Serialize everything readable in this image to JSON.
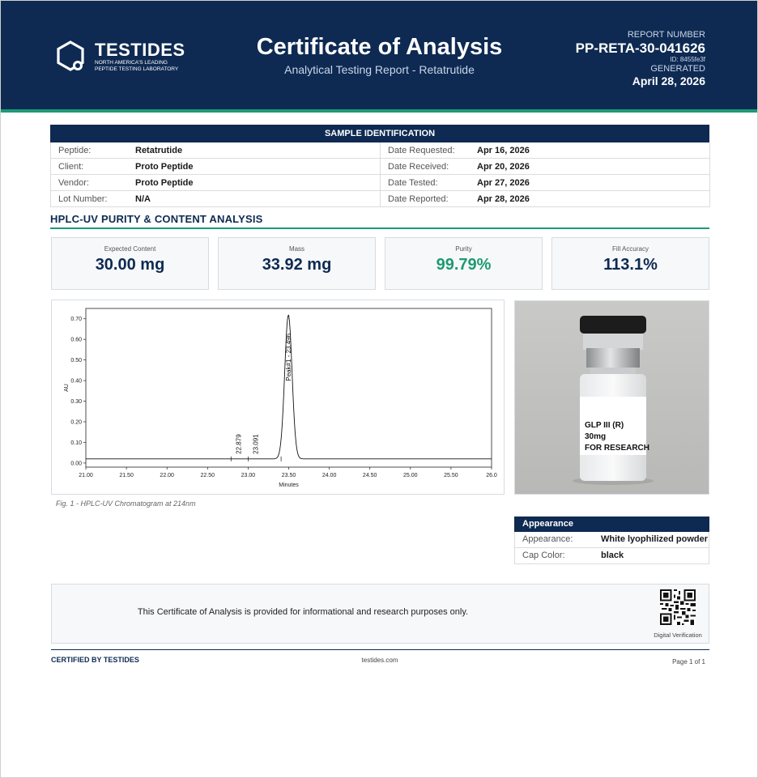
{
  "header": {
    "brand": "TESTIDES",
    "tagline_line1": "NORTH AMERICA'S LEADING",
    "tagline_line2": "PEPTIDE TESTING LABORATORY",
    "title": "Certificate of Analysis",
    "subtitle": "Analytical Testing Report  -  Retatrutide",
    "report_number_label": "REPORT NUMBER",
    "report_number": "PP-RETA-30-041626",
    "id_text": "ID: 8455fe3f",
    "generated_label": "GENERATED",
    "generated_date": "April 28, 2026"
  },
  "sample": {
    "heading": "SAMPLE IDENTIFICATION",
    "rows": [
      {
        "label": "Peptide:",
        "value": "Retatrutide",
        "label2": "Date Requested:",
        "value2": "Apr 16, 2026"
      },
      {
        "label": "Client:",
        "value": "Proto Peptide",
        "label2": "Date Received:",
        "value2": "Apr 20, 2026"
      },
      {
        "label": "Vendor:",
        "value": "Proto Peptide",
        "label2": "Date Tested:",
        "value2": "Apr 27, 2026"
      },
      {
        "label": "Lot Number:",
        "value": "N/A",
        "label2": "Date Reported:",
        "value2": "Apr 28, 2026"
      }
    ]
  },
  "analysis": {
    "heading": "HPLC-UV PURITY & CONTENT ANALYSIS",
    "metrics": [
      {
        "label": "Expected Content",
        "value": "30.00 mg"
      },
      {
        "label": "Mass",
        "value": "33.92 mg"
      },
      {
        "label": "Purity",
        "value": "99.79%"
      },
      {
        "label": "Fill Accuracy",
        "value": "113.1%"
      }
    ],
    "figure_caption": "Fig. 1  -  HPLC-UV Chromatogram at 214nm"
  },
  "chart_data": {
    "type": "line",
    "xlabel": "Minutes",
    "ylabel": "AU",
    "xlim": [
      21.0,
      26.0
    ],
    "ylim": [
      -0.02,
      0.75
    ],
    "x_ticks": [
      "21.00",
      "21.50",
      "22.00",
      "22.50",
      "23.00",
      "23.50",
      "24.00",
      "24.50",
      "25.00",
      "25.50",
      "26.0"
    ],
    "y_ticks": [
      "0.00",
      "0.10",
      "0.20",
      "0.30",
      "0.40",
      "0.50",
      "0.60",
      "0.70"
    ],
    "grid": false,
    "baseline": 0.02,
    "peaks": [
      {
        "label": "22.879",
        "x": 22.879,
        "y": 0.02
      },
      {
        "label": "23.091",
        "x": 23.091,
        "y": 0.02
      },
      {
        "label": "Peak#1 - 23.496",
        "x": 23.496,
        "y": 0.72
      }
    ]
  },
  "photo": {
    "label_line1": "GLP III (R)",
    "label_line2": "30mg",
    "label_line3": "FOR RESEARCH"
  },
  "appearance": {
    "heading": "Appearance",
    "rows": [
      {
        "label": "Appearance:",
        "value": "White lyophilized powder"
      },
      {
        "label": "Cap Color:",
        "value": "black"
      }
    ]
  },
  "disclaimer": {
    "text": "This Certificate of Analysis is provided for informational and research purposes only.",
    "qr_label": "Digital Verification"
  },
  "footer": {
    "left": "CERTIFIED BY TESTIDES",
    "center": "testides.com",
    "right": "Page 1 of 1"
  },
  "colors": {
    "navy": "#0e2a52",
    "green": "#1d9a74"
  }
}
